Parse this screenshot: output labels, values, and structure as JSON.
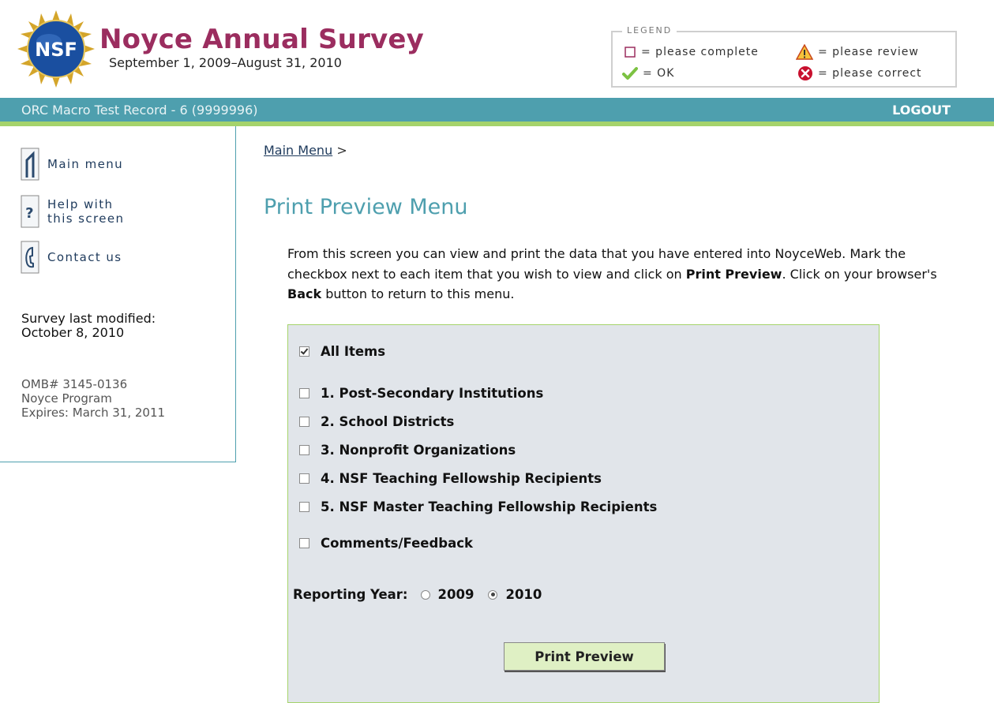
{
  "header": {
    "logo_text": "NSF",
    "title": "Noyce Annual Survey",
    "date_range": "September 1, 2009–August 31, 2010"
  },
  "legend": {
    "title": "LEGEND",
    "items": [
      {
        "icon": "empty-square-icon",
        "label": "= please complete"
      },
      {
        "icon": "warning-icon",
        "label": "= please review"
      },
      {
        "icon": "check-icon",
        "label": "= OK"
      },
      {
        "icon": "error-icon",
        "label": "= please correct"
      }
    ]
  },
  "topbar": {
    "record": "ORC Macro Test Record - 6 (9999996)",
    "logout": "LOGOUT"
  },
  "sidebar": {
    "links": [
      {
        "icon": "main-menu-icon",
        "label": "Main menu"
      },
      {
        "icon": "help-icon",
        "label": "Help with this screen"
      },
      {
        "icon": "phone-icon",
        "label": "Contact us"
      }
    ],
    "last_modified_label": "Survey last modified:",
    "last_modified_date": "October 8, 2010",
    "omb": "OMB# 3145-0136",
    "program": "Noyce Program",
    "expires": "Expires: March 31, 2011"
  },
  "breadcrumb": {
    "link": "Main Menu",
    "separator": ">"
  },
  "page_title": "Print Preview Menu",
  "instructions": {
    "part1": "From this screen you can view and print the data that you have entered into NoyceWeb. Mark the checkbox next to each item that you wish to view and click on ",
    "bold1": "Print Preview",
    "part2": ". Click on your browser's ",
    "bold2": "Back",
    "part3": " button to return to this menu."
  },
  "form": {
    "items": [
      {
        "label": "All Items",
        "checked": true
      },
      {
        "label": "1. Post-Secondary Institutions",
        "checked": false
      },
      {
        "label": "2. School Districts",
        "checked": false
      },
      {
        "label": "3. Nonprofit Organizations",
        "checked": false
      },
      {
        "label": "4. NSF Teaching Fellowship Recipients",
        "checked": false
      },
      {
        "label": "5. NSF Master Teaching Fellowship Recipients",
        "checked": false
      },
      {
        "label": "Comments/Feedback",
        "checked": false
      }
    ],
    "reporting_year_label": "Reporting Year:",
    "years": [
      {
        "label": "2009",
        "selected": false
      },
      {
        "label": "2010",
        "selected": true
      }
    ],
    "print_button": "Print Preview"
  },
  "colors": {
    "title": "#9b2d5f",
    "topbar": "#4e9fae",
    "accent_line": "#a5d36b",
    "panel": "#e1e5ea",
    "button": "#dff0c4"
  }
}
